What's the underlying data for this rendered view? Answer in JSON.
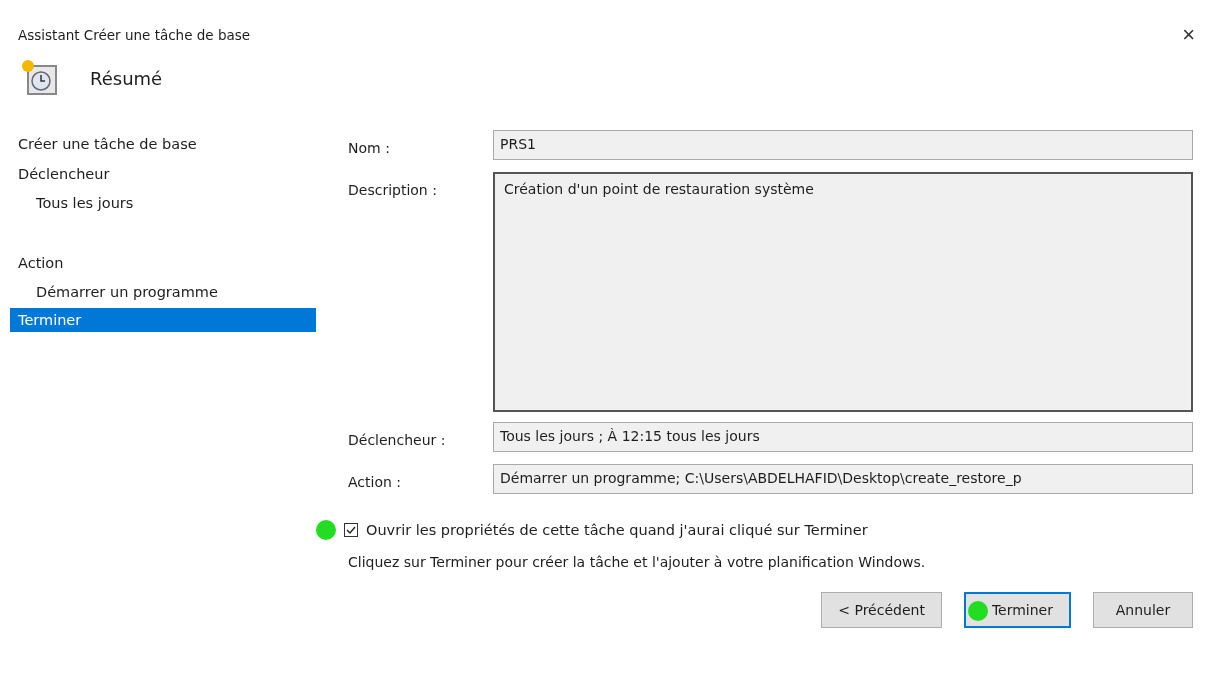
{
  "window": {
    "title": "Assistant Créer une tâche de base",
    "close": "×"
  },
  "header": {
    "title": "Résumé"
  },
  "sidebar": {
    "items": [
      {
        "label": "Créer une tâche de base",
        "selected": false
      },
      {
        "label": "Déclencheur",
        "selected": false,
        "children": [
          {
            "label": "Tous les jours",
            "selected": false
          }
        ]
      },
      {
        "label": "Action",
        "selected": false,
        "children": [
          {
            "label": "Démarrer un programme",
            "selected": false
          }
        ]
      },
      {
        "label": "Terminer",
        "selected": true
      }
    ]
  },
  "fields": [
    {
      "label": "Nom :",
      "value": "PRS1",
      "kind": "single"
    },
    {
      "label": "Description :",
      "value": "Création d'un point de restauration système",
      "kind": "multi"
    },
    {
      "label": "Déclencheur :",
      "value": "Tous les jours ; À 12:15 tous les jours",
      "kind": "single"
    },
    {
      "label": "Action :",
      "value": "Démarrer un programme; C:\\Users\\ABDELHAFID\\Desktop\\create_restore_p",
      "kind": "single"
    }
  ],
  "open_properties": {
    "label": "Ouvrir les propriétés de cette tâche quand j'aurai cliqué sur Terminer",
    "checked": true,
    "annotated": true
  },
  "info": "Cliquez sur Terminer pour créer la tâche et l'ajouter à votre planification Windows.",
  "buttons": [
    {
      "label": "< Précédent",
      "default": false,
      "annotated": false
    },
    {
      "label": "Terminer",
      "default": true,
      "annotated": true
    },
    {
      "label": "Annuler",
      "default": false,
      "annotated": false
    }
  ]
}
